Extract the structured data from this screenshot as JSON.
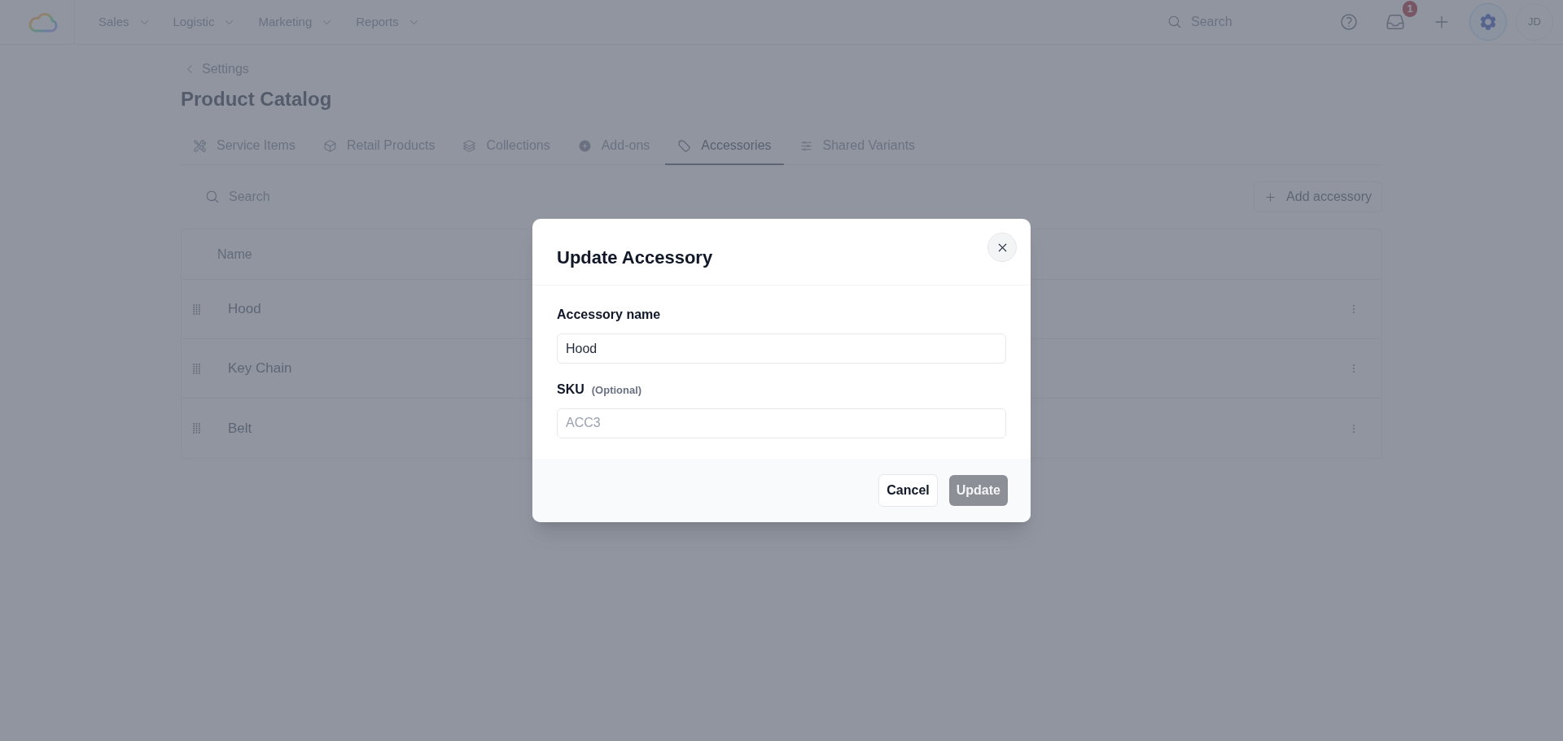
{
  "topbar": {
    "nav": [
      {
        "label": "Sales"
      },
      {
        "label": "Logistic"
      },
      {
        "label": "Marketing"
      },
      {
        "label": "Reports"
      }
    ],
    "search": {
      "placeholder": "Search"
    },
    "inbox_badge": "1",
    "settings_selected": true,
    "avatar": "JD"
  },
  "breadcrumb": {
    "label": "Settings"
  },
  "page_title": "Product Catalog",
  "tabs": [
    {
      "label": "Service Items",
      "selected": false
    },
    {
      "label": "Retail Products",
      "selected": false
    },
    {
      "label": "Collections",
      "selected": false
    },
    {
      "label": "Add-ons",
      "selected": false
    },
    {
      "label": "Accessories",
      "selected": true
    },
    {
      "label": "Shared Variants",
      "selected": false
    }
  ],
  "toolbar": {
    "search": {
      "placeholder": "Search"
    },
    "add_button": "Add accessory"
  },
  "table": {
    "columns": [
      "Name"
    ],
    "rows": [
      {
        "name": "Hood"
      },
      {
        "name": "Key Chain"
      },
      {
        "name": "Belt"
      }
    ]
  },
  "modal": {
    "title": "Update Accessory",
    "fields": [
      {
        "label": "Accessory name",
        "value": "Hood"
      },
      {
        "label": "SKU",
        "note": "(Optional)",
        "placeholder": "ACC3"
      }
    ],
    "buttons": [
      {
        "label": "Cancel",
        "kind": "secondary",
        "disabled": false
      },
      {
        "label": "Update",
        "kind": "primary",
        "disabled": true
      }
    ]
  }
}
